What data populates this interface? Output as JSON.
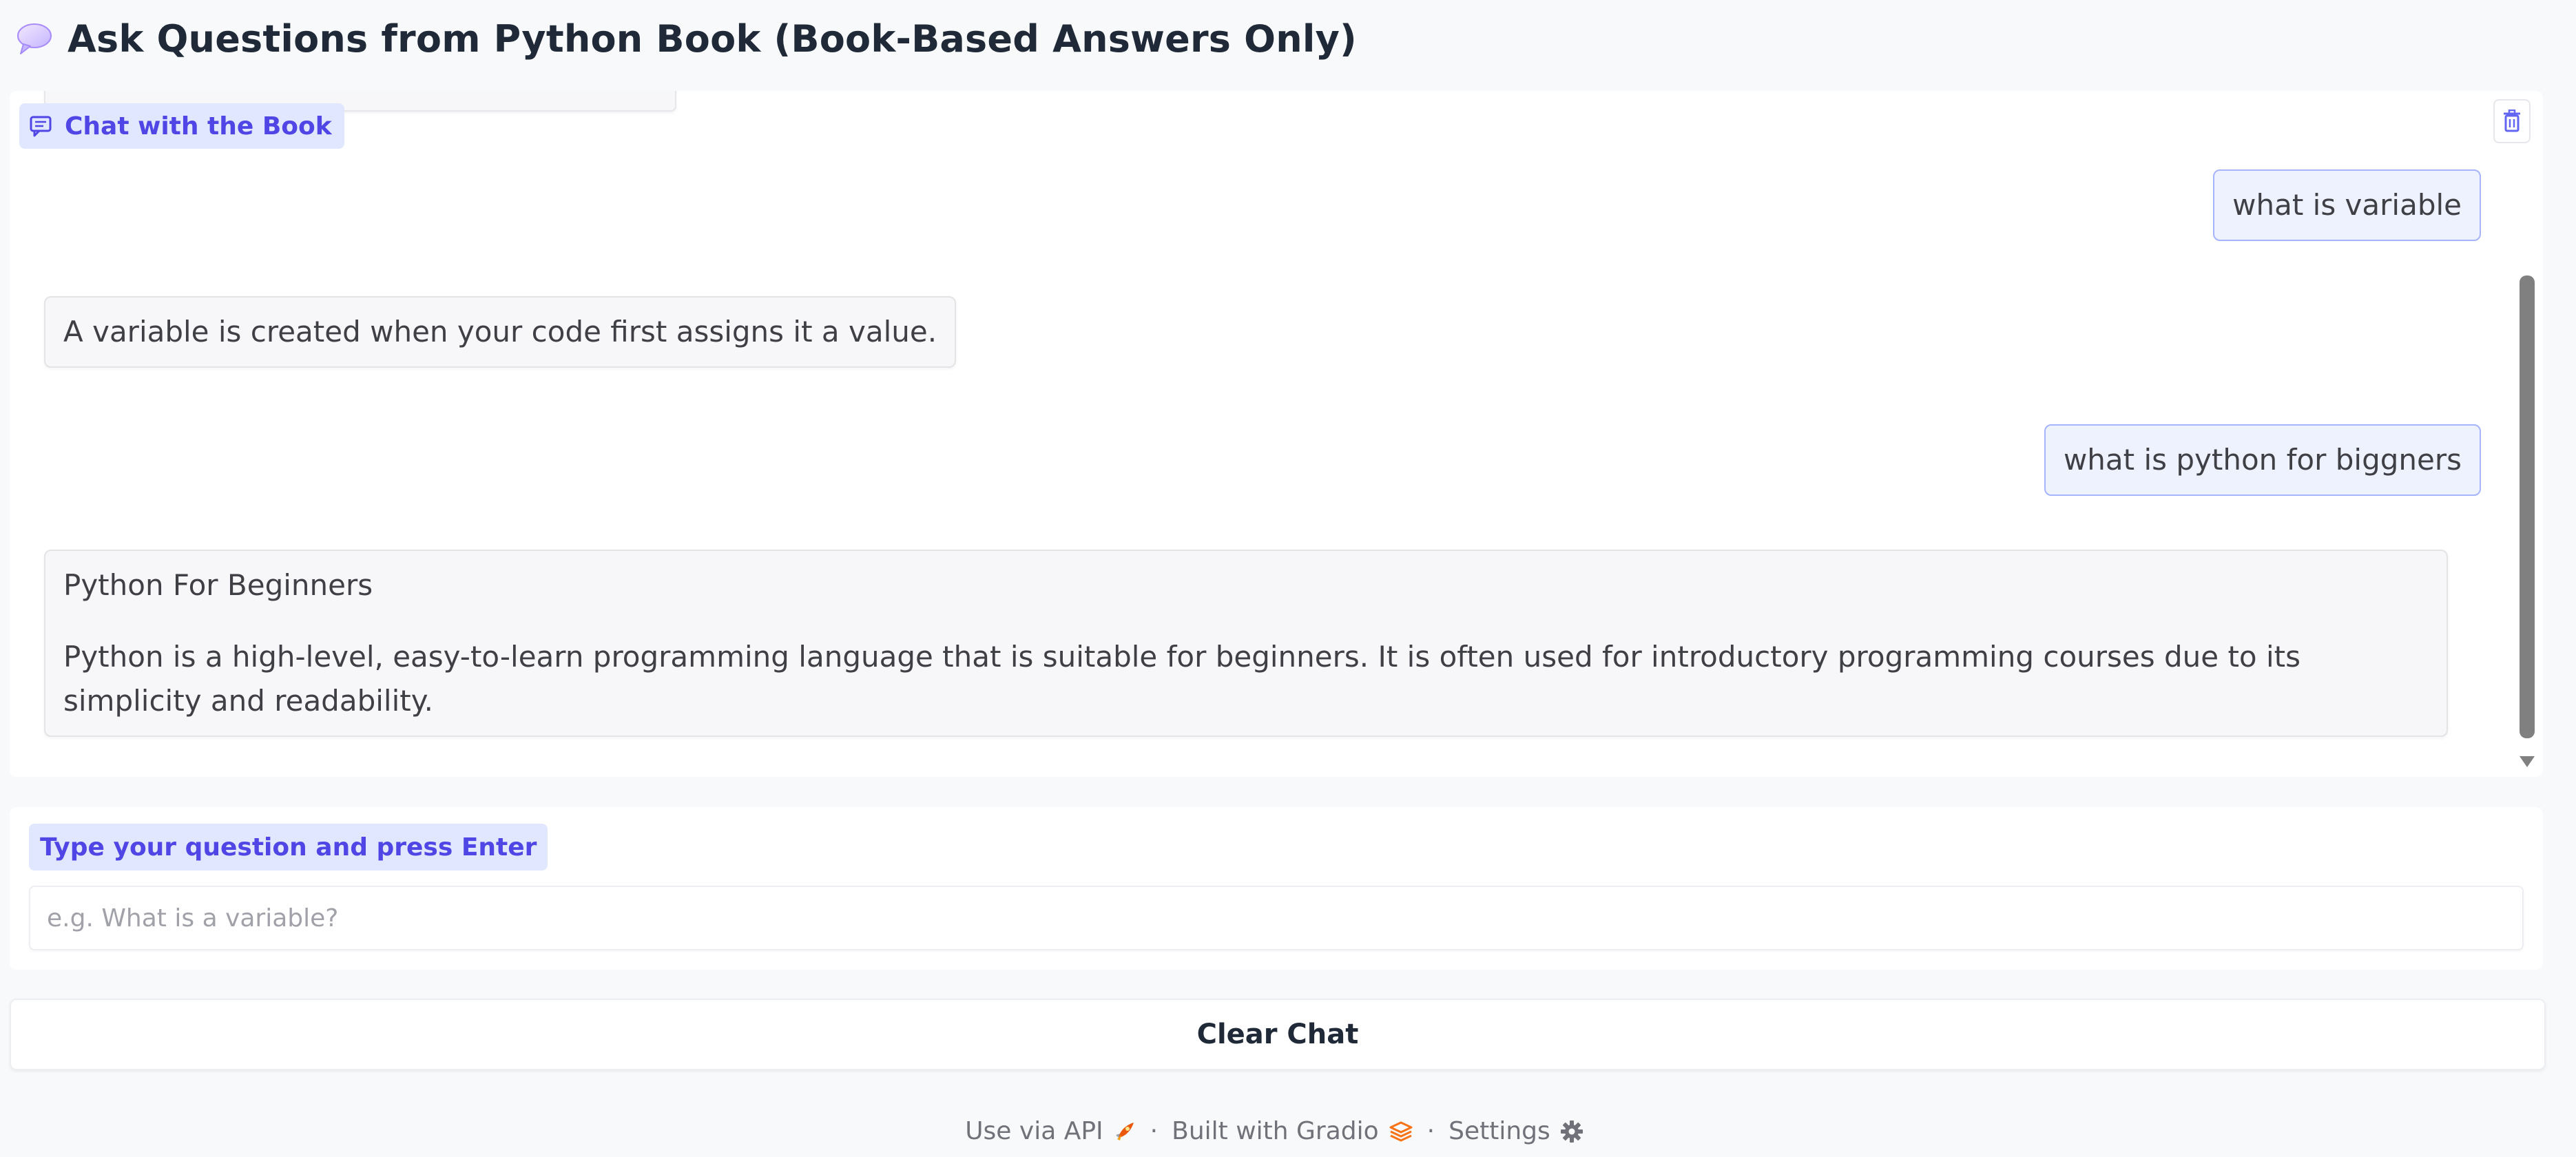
{
  "header": {
    "title": "Ask Questions from Python Book (Book-Based Answers Only)",
    "icon": "speech-bubble-icon"
  },
  "chatbot": {
    "label": "Chat with the Book",
    "label_icon": "chat-icon",
    "clear_icon": "trash-icon",
    "messages": [
      {
        "role": "user",
        "text": "what is variable"
      },
      {
        "role": "bot",
        "text": "A variable is created when your code first assigns it a value."
      },
      {
        "role": "user",
        "text": "what is python for biggners"
      },
      {
        "role": "bot",
        "heading": "Python For Beginners",
        "text": "Python is a high-level, easy-to-learn programming language that is suitable for beginners. It is often used for introductory programming courses due to its simplicity and readability."
      }
    ]
  },
  "question_box": {
    "label": "Type your question and press Enter",
    "placeholder": "e.g. What is a variable?",
    "value": ""
  },
  "clear_button": {
    "label": "Clear Chat"
  },
  "footer": {
    "api_link": "Use via API",
    "api_icon": "rocket-icon",
    "built_with": "Built with Gradio",
    "gradio_icon": "gradio-logo-icon",
    "settings_link": "Settings",
    "settings_icon": "gear-icon",
    "separator": "·"
  },
  "colors": {
    "accent": "#4f46e5",
    "label_bg": "#e0e7ff",
    "user_bubble_bg": "#eef2ff",
    "user_bubble_border": "#a5b4fc",
    "page_bg": "#f8f9fb",
    "gradio_orange": "#f97316"
  }
}
